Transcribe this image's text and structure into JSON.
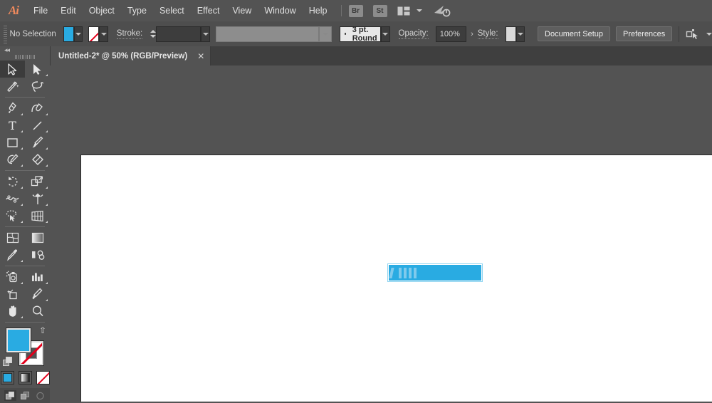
{
  "app": {
    "name": "Adobe Illustrator",
    "logo_text": "Ai"
  },
  "menubar": {
    "items": [
      {
        "label": "File",
        "name": "menu-file"
      },
      {
        "label": "Edit",
        "name": "menu-edit"
      },
      {
        "label": "Object",
        "name": "menu-object"
      },
      {
        "label": "Type",
        "name": "menu-type"
      },
      {
        "label": "Select",
        "name": "menu-select"
      },
      {
        "label": "Effect",
        "name": "menu-effect"
      },
      {
        "label": "View",
        "name": "menu-view"
      },
      {
        "label": "Window",
        "name": "menu-window"
      },
      {
        "label": "Help",
        "name": "menu-help"
      }
    ],
    "bridge_button": "Br",
    "stock_button": "St",
    "arrange_icon": "arrange-documents-icon",
    "sync_icon": "cc-sync-icon"
  },
  "controlbar": {
    "selection_status": "No Selection",
    "fill_color": "#29abe2",
    "stroke_color": "none",
    "stroke_label": "Stroke:",
    "stroke_weight": "",
    "stroke_profile": "",
    "brush_definition": "3 pt. Round",
    "opacity_label": "Opacity:",
    "opacity_value": "100%",
    "style_label": "Style:",
    "style_swatch": "#d9d9d9",
    "document_setup_button": "Document Setup",
    "preferences_button": "Preferences",
    "transform_icon": "transform-panel-icon"
  },
  "tabbar": {
    "tabs": [
      {
        "title": "Untitled-2* @ 50% (RGB/Preview)",
        "close_label": "✕",
        "active": true
      }
    ]
  },
  "toolbar": {
    "collapse_label": "◀◀",
    "tools": [
      {
        "name": "selection-tool",
        "label": "Selection",
        "selected": true,
        "corner": false
      },
      {
        "name": "direct-selection-tool",
        "label": "Direct Selection",
        "selected": false,
        "corner": true
      },
      {
        "name": "magic-wand-tool",
        "label": "Magic Wand",
        "selected": false,
        "corner": false
      },
      {
        "name": "lasso-tool",
        "label": "Lasso",
        "selected": false,
        "corner": false
      },
      {
        "name": "pen-tool",
        "label": "Pen",
        "selected": false,
        "corner": true
      },
      {
        "name": "curvature-tool",
        "label": "Curvature",
        "selected": false,
        "corner": true
      },
      {
        "name": "type-tool",
        "label": "Type",
        "selected": false,
        "corner": true
      },
      {
        "name": "line-segment-tool",
        "label": "Line Segment",
        "selected": false,
        "corner": true
      },
      {
        "name": "rectangle-tool",
        "label": "Rectangle",
        "selected": false,
        "corner": true
      },
      {
        "name": "paintbrush-tool",
        "label": "Paintbrush",
        "selected": false,
        "corner": true
      },
      {
        "name": "shaper-tool",
        "label": "Shaper / Pencil",
        "selected": false,
        "corner": true
      },
      {
        "name": "eraser-tool",
        "label": "Eraser",
        "selected": false,
        "corner": true
      },
      {
        "name": "rotate-tool",
        "label": "Rotate",
        "selected": false,
        "corner": true
      },
      {
        "name": "scale-tool",
        "label": "Scale",
        "selected": false,
        "corner": true
      },
      {
        "name": "width-tool",
        "label": "Width / Warp",
        "selected": false,
        "corner": true
      },
      {
        "name": "free-transform-tool",
        "label": "Free Transform",
        "selected": false,
        "corner": true
      },
      {
        "name": "shape-builder-tool",
        "label": "Shape Builder",
        "selected": false,
        "corner": true
      },
      {
        "name": "perspective-grid-tool",
        "label": "Perspective Grid",
        "selected": false,
        "corner": true
      },
      {
        "name": "mesh-tool",
        "label": "Mesh",
        "selected": false,
        "corner": false
      },
      {
        "name": "gradient-tool",
        "label": "Gradient",
        "selected": false,
        "corner": false
      },
      {
        "name": "eyedropper-tool",
        "label": "Eyedropper",
        "selected": false,
        "corner": true
      },
      {
        "name": "blend-tool",
        "label": "Blend",
        "selected": false,
        "corner": false
      },
      {
        "name": "symbol-sprayer-tool",
        "label": "Symbol Sprayer",
        "selected": false,
        "corner": true
      },
      {
        "name": "column-graph-tool",
        "label": "Column Graph",
        "selected": false,
        "corner": true
      },
      {
        "name": "artboard-tool",
        "label": "Artboard",
        "selected": false,
        "corner": false
      },
      {
        "name": "slice-tool",
        "label": "Slice",
        "selected": false,
        "corner": true
      },
      {
        "name": "hand-tool",
        "label": "Hand",
        "selected": false,
        "corner": true
      },
      {
        "name": "zoom-tool",
        "label": "Zoom",
        "selected": false,
        "corner": false
      }
    ],
    "fill_stroke": {
      "fill_color": "#29abe2",
      "stroke_color": "none",
      "swap_icon": "swap-fill-stroke-icon",
      "default_icon": "default-fill-stroke-icon"
    },
    "color_modes": [
      {
        "name": "color-mode-button",
        "label": "Color",
        "selected": true
      },
      {
        "name": "gradient-mode-button",
        "label": "Gradient",
        "selected": false
      },
      {
        "name": "none-mode-button",
        "label": "None",
        "selected": false
      }
    ],
    "draw_modes": [
      {
        "name": "draw-normal-button",
        "label": "Draw Normal",
        "selected": true
      },
      {
        "name": "draw-behind-button",
        "label": "Draw Behind",
        "selected": false
      },
      {
        "name": "draw-inside-button",
        "label": "Draw Inside",
        "selected": false
      }
    ]
  },
  "canvas": {
    "zoom_level": "50%",
    "background_color": "#535353",
    "artboard_color": "#ffffff",
    "selected_object": {
      "name": "blue-rectangle",
      "fill": "#29abe2",
      "highlight": "#7fcaec",
      "selected": true
    }
  }
}
